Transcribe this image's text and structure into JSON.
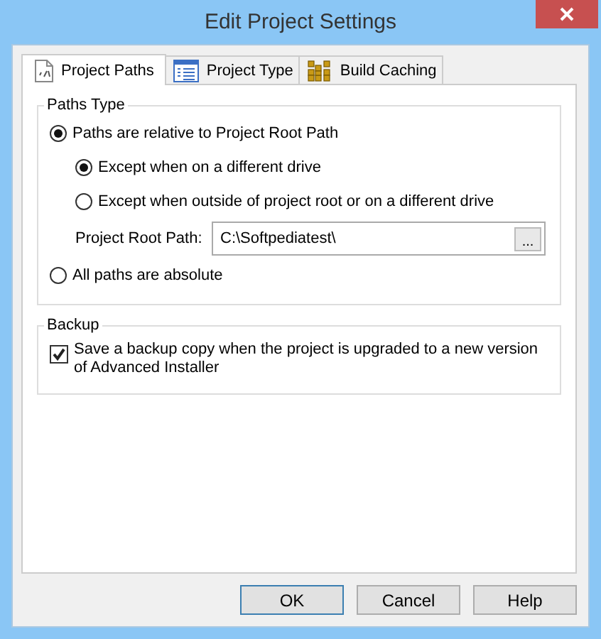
{
  "window": {
    "title": "Edit Project Settings"
  },
  "tabs": [
    {
      "label": "Project Paths",
      "selected": true
    },
    {
      "label": "Project Type",
      "selected": false
    },
    {
      "label": "Build Caching",
      "selected": false
    }
  ],
  "paths_type": {
    "legend": "Paths Type",
    "relative": {
      "label": "Paths are relative to Project Root Path",
      "selected": true,
      "children": [
        {
          "label": "Except when on a different drive",
          "selected": true
        },
        {
          "label": "Except when outside of project root or on a different drive",
          "selected": false
        }
      ],
      "root_path": {
        "label": "Project Root Path:",
        "value": "C:\\Softpediatest\\",
        "browse": "..."
      }
    },
    "absolute": {
      "label": "All paths are absolute",
      "selected": false
    }
  },
  "backup": {
    "legend": "Backup",
    "label": "Save a backup copy when the project is upgraded to a new version of Advanced Installer",
    "checked": true
  },
  "buttons": [
    {
      "label": "OK",
      "default": true
    },
    {
      "label": "Cancel",
      "default": false
    },
    {
      "label": "Help",
      "default": false
    }
  ]
}
